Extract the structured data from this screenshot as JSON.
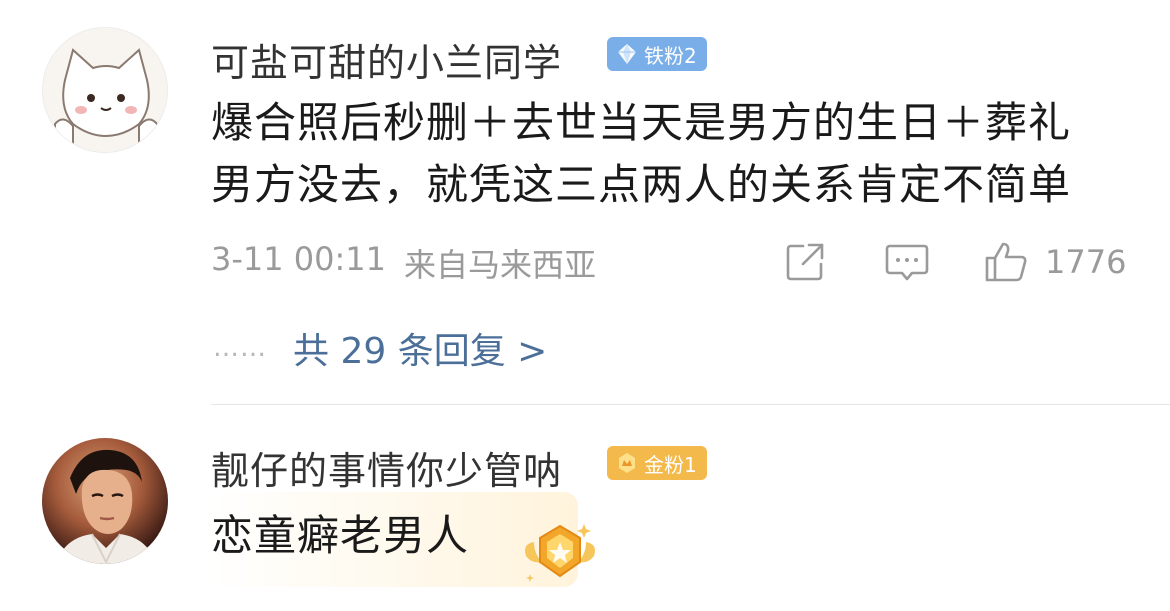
{
  "comments": [
    {
      "username": "可盐可甜的小兰同学",
      "badge": {
        "label": "铁粉2",
        "icon": "diamond-icon",
        "color": "#79aee8"
      },
      "content_lines": [
        "爆合照后秒删＋去世当天是男方的生日＋葬礼",
        "男方没去，就凭这三点两人的关系肯定不简单"
      ],
      "timestamp": "3-11 00:11",
      "location": "来自马来西亚",
      "like_count": "1776",
      "replies_link": "共 29 条回复 >",
      "replies_prefix": "……"
    },
    {
      "username": "靓仔的事情你少管呐",
      "badge": {
        "label": "金粉1",
        "icon": "gold-crown-icon",
        "color": "#f3b94a"
      },
      "content": "恋童癖老男人"
    }
  ],
  "colors": {
    "link": "#4b6f99",
    "meta": "#9a9a9a",
    "text": "#1a1a1a",
    "username": "#333333"
  }
}
